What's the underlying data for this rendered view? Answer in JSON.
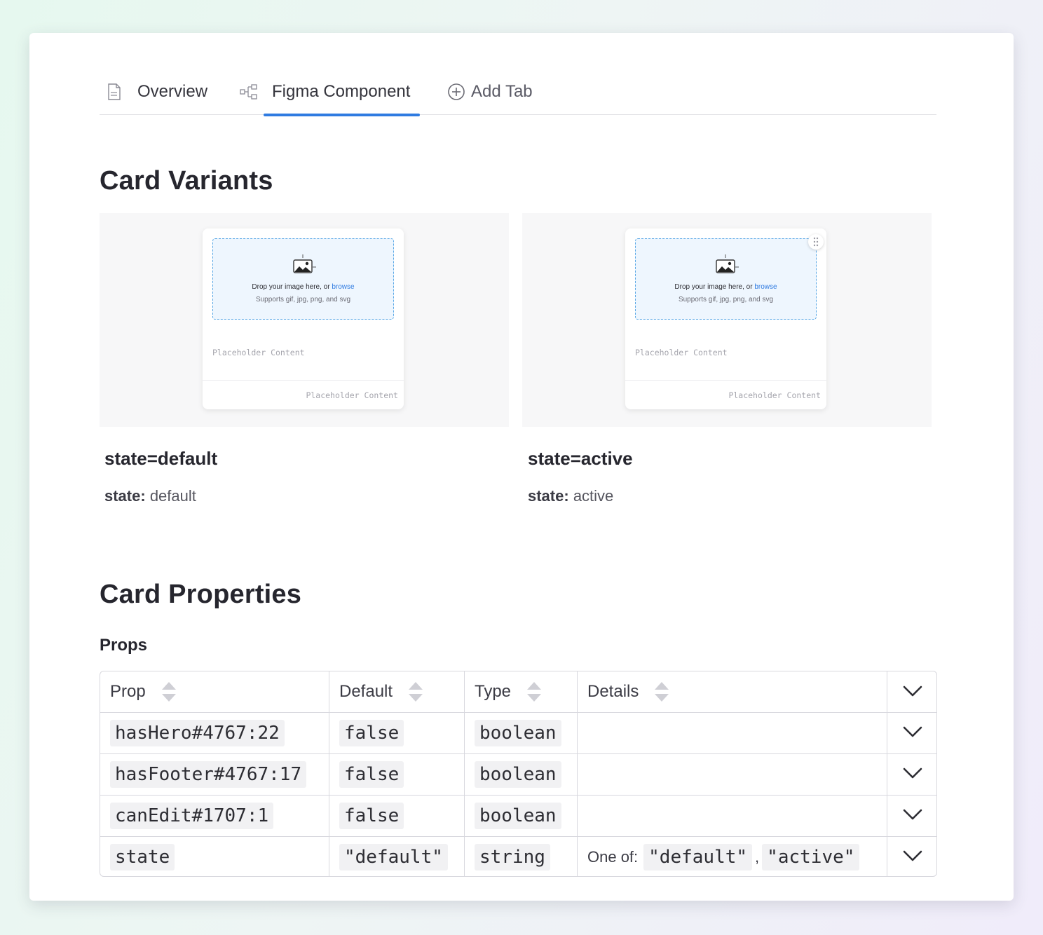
{
  "tabs": [
    {
      "label": "Overview",
      "icon": "document-icon",
      "active": false
    },
    {
      "label": "Figma Component",
      "icon": "component-tree-icon",
      "active": true
    },
    {
      "label": "Add Tab",
      "icon": "plus-circle-icon",
      "active": false
    }
  ],
  "variants": {
    "heading": "Card Variants",
    "items": [
      {
        "title": "state=default",
        "meta_key": "state:",
        "meta_value": "default",
        "card": {
          "drop_text": "Drop your image here, or ",
          "browse": "browse",
          "supports": "Supports gif, jpg, png, and svg",
          "body": "Placeholder Content",
          "footer": "Placeholder Content"
        }
      },
      {
        "title": "state=active",
        "meta_key": "state:",
        "meta_value": "active",
        "card": {
          "drop_text": "Drop your image here, or ",
          "browse": "browse",
          "supports": "Supports gif, jpg, png, and svg",
          "body": "Placeholder Content",
          "footer": "Placeholder Content"
        }
      }
    ]
  },
  "properties": {
    "heading": "Card Properties",
    "subheading": "Props",
    "columns": [
      "Prop",
      "Default",
      "Type",
      "Details"
    ],
    "rows": [
      {
        "prop": "hasHero#4767:22",
        "default": "false",
        "type": "boolean",
        "details": ""
      },
      {
        "prop": "hasFooter#4767:17",
        "default": "false",
        "type": "boolean",
        "details": ""
      },
      {
        "prop": "canEdit#1707:1",
        "default": "false",
        "type": "boolean",
        "details": ""
      },
      {
        "prop": "state",
        "default": "\"default\"",
        "type": "string",
        "details_label": "One of:",
        "details_values": [
          "\"default\"",
          "\"active\""
        ],
        "separator": ","
      }
    ]
  },
  "colors": {
    "accent": "#2f7be1",
    "dropzone_bg": "#eef6fe",
    "dropzone_border": "#5aa8e6"
  }
}
